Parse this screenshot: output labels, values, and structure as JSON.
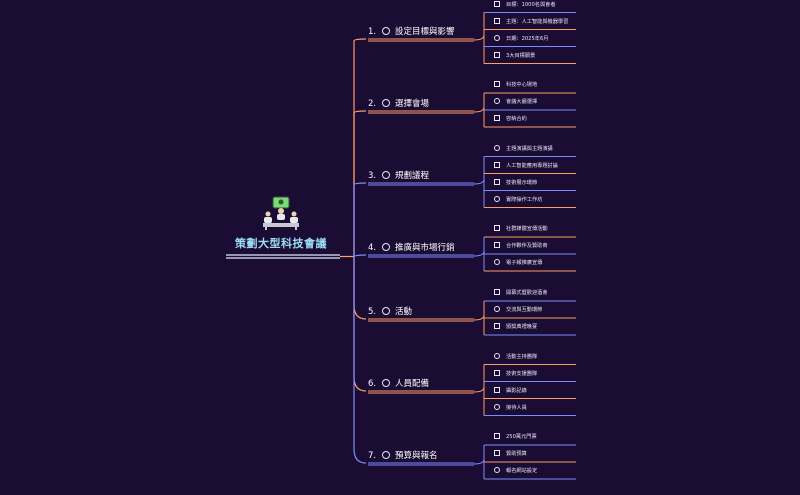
{
  "root": {
    "title": "策劃大型科技會議",
    "icon": "presenter-meeting-icon"
  },
  "colors": {
    "background": "#1b0c33",
    "root_text": "#9bdcf5",
    "root_line": "#dfe8ff",
    "connector_warm": "#ff9d66",
    "connector_cool": "#7f8cff"
  },
  "branches": [
    {
      "num": "1.",
      "label": "設定目標與影響",
      "items": [
        "目標：1000名與會者",
        "主題：人工智能與機器學習",
        "日期：2025年6月",
        "3大目標願景"
      ]
    },
    {
      "num": "2.",
      "label": "選擇會場",
      "items": [
        "科技中心場地",
        "會議大廳選擇",
        "容納合約"
      ]
    },
    {
      "num": "3.",
      "label": "規劃議程",
      "items": [
        "主題演講與主題演講",
        "人工智能應用專題討論",
        "技術展示環節",
        "實際操作工作坊"
      ]
    },
    {
      "num": "4.",
      "label": "推廣與市場行銷",
      "items": [
        "社群媒體宣傳活動",
        "合作夥伴及贊助商",
        "電子報推廣宣傳"
      ]
    },
    {
      "num": "5.",
      "label": "活動",
      "items": [
        "開幕式暨歡迎酒會",
        "交流與互動環節",
        "頒獎典禮晚宴"
      ]
    },
    {
      "num": "6.",
      "label": "人員配備",
      "items": [
        "活動主持團隊",
        "技術支援團隊",
        "攝影記錄",
        "接待人員"
      ]
    },
    {
      "num": "7.",
      "label": "預算與報名",
      "items": [
        "250萬元門票",
        "贊助預算",
        "報名網站設定"
      ]
    }
  ]
}
